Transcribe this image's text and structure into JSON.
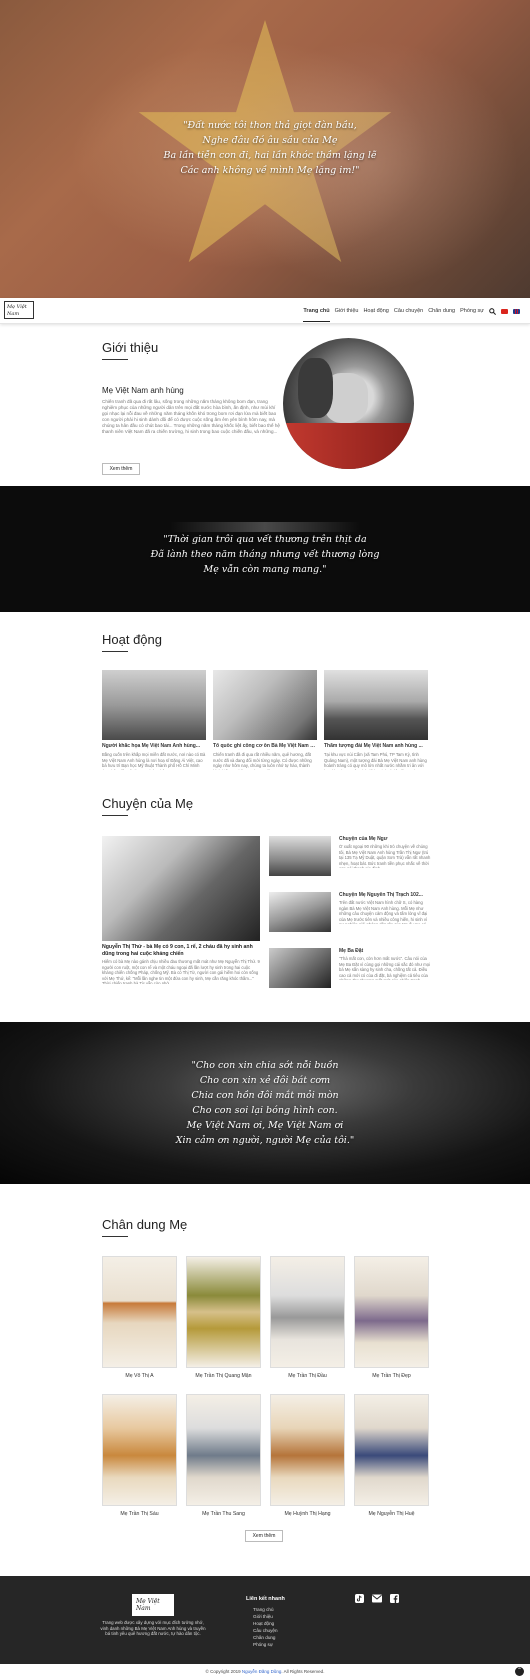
{
  "hero": {
    "quote_lines": [
      "\"Đất nước tôi thon thả giọt đàn bầu,",
      "Nghe đâu đó âu sầu của Mẹ",
      "Ba lần tiễn con đi, hai lần khóc thầm lặng lẽ",
      "Các anh không về mình Mẹ lặng im!\""
    ]
  },
  "nav": {
    "logo_text": "Mẹ Việt Nam",
    "items": [
      "Trang chủ",
      "Giới thiệu",
      "Hoạt động",
      "Câu chuyện",
      "Chân dung",
      "Phóng sự"
    ],
    "active": "Trang chủ",
    "icons": [
      "search-icon",
      "flag-vn-icon",
      "flag-uk-icon"
    ],
    "accent": "#222222"
  },
  "intro": {
    "section_title": "Giới thiệu",
    "subtitle": "Mẹ Việt Nam anh hùng",
    "body": "Chiến tranh đã qua đi rất lâu, sống trong những năm tháng không bom đạn, trang nghiêm phục của những người dân trên mọi đất nước hòa bình, ấn định, như mùi khí gọi nhạc lại nỗi đau về những năm tháng khốn khó trong bom rơi đạn lửa mà biết bao con người phải hi sinh dành dồi để có được cuộc sống ấm êm yên bình hôm nay, mà chúng ta hân đầu có chút bao tài... Trong những năm tháng khốc liệt ấy, biết bao thế hệ thanh niên Việt Nam đã ra chiến trường, hi sinh trong bao cuộc chiến đấu, và những...",
    "button": "Xem thêm"
  },
  "band1": {
    "quote_lines": [
      "\"Thời gian trôi qua vết thương trên thịt da",
      "Đã lành theo năm tháng nhưng vết thương lòng",
      "Mẹ vẫn còn mang mang.\""
    ]
  },
  "activities": {
    "section_title": "Hoạt động",
    "items": [
      {
        "title": "Người khắc họa Mẹ Việt Nam Anh hùng...",
        "text": "Bằng cuốn trên khắp mọi miền đất nước, nơi nào có Bà Mẹ Việt Nam Anh hùng là nơi hoạ sĩ Đặng Ái Việt, cao bà hưu trí Bạn học Mỹ thuật Thành phố Hồ Chí Minh thu nhập đến vẽ tặng Mẹ bức chân..."
      },
      {
        "title": "Tổ quốc ghi công cơ ôn Bà Mẹ Việt Nam an...",
        "text": "Chiến tranh đã đi qua rất nhiều năm, quê hương, đất nước đã và đang đổi mới từng ngày. Có được những ngày như hôm nay, chúng ta luôn nhớ tự hào, thành kính biết ơn những \"Bà Mẹ Việt Nam..."
      },
      {
        "title": "Thăm tượng đài Mẹ Việt Nam anh hùng ...",
        "text": "Tại khu vực núi Cấm (xã Tam Phú, TP Tam Kỳ, tỉnh Quảng Nam), một tượng đài Bà Mẹ Việt Nam anh hùng hoành tráng có quy mô lớn nhất nước nhằm tri ân với bao lớp cha mẹ ông bà đã hy sinh vì độc lập tự do..."
      }
    ]
  },
  "stories": {
    "section_title": "Chuyện của Mẹ",
    "main_title": "Nguyễn Thị Thứ - bà Mẹ có 9 con, 1 rể, 2 cháu đã hy sinh anh dũng trong hai cuộc kháng chiến",
    "main_text": "Hiếm có bà Mẹ nào gánh chịu nhiều đau thương mất mát như Mẹ Nguyễn Thị Thứ. 9 người con ruột, một con rể và một cháu ngoại đã lần lượt hy sinh trong hai cuộc kháng chiến chống Pháp, chống Mỹ. Bà có Thị Từ, người con gái hiếm hoi còn sống với Mẹ Thứ, kể: \"Mỗi lần nghe tin một đứa con hy sinh, Mẹ cắn răng khóc thầm...\" Thời chiến tranh bà Từ vẫn còn nhớ...",
    "side": [
      {
        "title": "Chuyện của Mẹ Ngư",
        "text": "Ở xuất ngoại 90 những khi trò chuyện về chúng tôi, Bà Mẹ Việt Nam Anh hùng Trần Thị Ngư (trú tại 135 Tạ Mỹ Duật, quận Sơn Trà) vẫn rất nhanh nhẹn, hoạt bát. Bức tranh tiền phục nhắc về thời con gái thanh gia đình..."
      },
      {
        "title": "Chuyện Mẹ Nguyễn Thị Trạch 102...",
        "text": "Trên đất nước Việt Nam hình chữ S, có hàng ngàn Bà Mẹ Việt Nam Anh hùng. Mỗi Mẹ như những câu chuyện cảm động và tấm lòng vĩ đại của Mẹ trước tiên và nhiều công hiến, hi sinh vì sự nghiệp giải phóng dân tộc của Mẹ ấy mẹ có cũng Bà Mẹ Nguyễn Thị Trạch. Trong đó có..."
      },
      {
        "title": "Mẹ Ba Đặt",
        "text": "\"Thà mất con, còn hơn mất nước\". Câu nói của Mẹ Ba Đặt vì cùng gọi những cái sắc đó như mọi bà Mẹ sẵn sàng hy sinh cha, chồng tất cả. Điều cao cả mới có của đi đặt, bà nghiệm cả tiêu của những đau thương mất mát của chiến tranh..."
      }
    ]
  },
  "band2": {
    "quote_lines": [
      "\"Cho con xin chia sớt nỗi buồn",
      "Cho con xin xẻ đôi bát cơm",
      "Chia con hồn đôi mắt mỏi mòn",
      "Cho con soi lại bóng hình con.",
      "Mẹ Việt Nam ơi, Mẹ Việt Nam ơi",
      "Xin cảm ơn người, người Mẹ của tôi.\""
    ]
  },
  "portraits": {
    "section_title": "Chân dung Mẹ",
    "names": [
      "Mẹ Võ Thị A",
      "Mẹ Trần Thị Quang Mận",
      "Mẹ Trần Thị Đầu",
      "Mẹ Trần Thị Đẹp",
      "Mẹ Trần Thị Sáu",
      "Mẹ Trần Thu Sang",
      "Mẹ Huỳnh Thị Hạng",
      "Mẹ Nguyễn Thị Huệ"
    ],
    "button": "Xem thêm"
  },
  "footer": {
    "logo_text": "Mẹ Việt Nam",
    "description": "Trang web được xây dựng với mục đích tưởng nhớ, vinh danh những Bà Mẹ Việt Nam Anh hùng và truyền bá tinh yêu quê hương đất nước, tự hào dân tộc.",
    "links_title": "Liên kết nhanh",
    "links": [
      "Trang chủ",
      "Giới thiệu",
      "Hoạt động",
      "Câu chuyện",
      "Chân dung",
      "Phóng sự"
    ],
    "social_icons": [
      "tiktok-icon",
      "mail-icon",
      "facebook-icon"
    ],
    "copyright_prefix": "© Copyright 2019 ",
    "copyright_author": "Nguyễn Đăng Dũng",
    "copyright_suffix": ". All Rights Reserved.",
    "author_color": "#3366cc"
  }
}
